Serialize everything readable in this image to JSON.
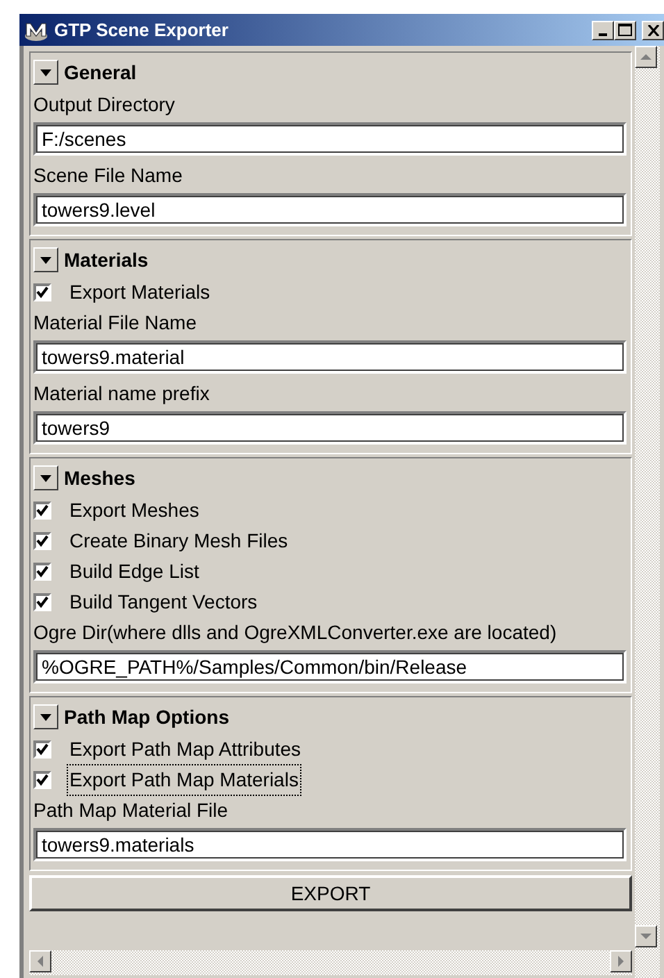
{
  "window": {
    "title": "GTP Scene Exporter"
  },
  "sections": [
    {
      "title": "General",
      "expanded": true,
      "items": [
        {
          "kind": "label",
          "text": "Output Directory"
        },
        {
          "kind": "field",
          "value": "F:/scenes"
        },
        {
          "kind": "label",
          "text": "Scene File Name"
        },
        {
          "kind": "field",
          "value": "towers9.level"
        }
      ]
    },
    {
      "title": "Materials",
      "expanded": true,
      "items": [
        {
          "kind": "checkbox",
          "text": "Export Materials",
          "checked": true,
          "focused": false
        },
        {
          "kind": "label",
          "text": "Material File Name"
        },
        {
          "kind": "field",
          "value": "towers9.material"
        },
        {
          "kind": "label",
          "text": "Material name prefix"
        },
        {
          "kind": "field",
          "value": "towers9"
        }
      ]
    },
    {
      "title": "Meshes",
      "expanded": true,
      "items": [
        {
          "kind": "checkbox",
          "text": "Export Meshes",
          "checked": true,
          "focused": false
        },
        {
          "kind": "checkbox",
          "text": "Create Binary Mesh Files",
          "checked": true,
          "focused": false
        },
        {
          "kind": "checkbox",
          "text": "Build Edge List",
          "checked": true,
          "focused": false
        },
        {
          "kind": "checkbox",
          "text": "Build Tangent Vectors",
          "checked": true,
          "focused": false
        },
        {
          "kind": "label",
          "text": "Ogre Dir(where dlls and OgreXMLConverter.exe are located)"
        },
        {
          "kind": "field",
          "value": "%OGRE_PATH%/Samples/Common/bin/Release"
        }
      ]
    },
    {
      "title": "Path Map Options",
      "expanded": true,
      "items": [
        {
          "kind": "checkbox",
          "text": "Export Path Map Attributes",
          "checked": true,
          "focused": false
        },
        {
          "kind": "checkbox",
          "text": "Export Path Map Materials",
          "checked": true,
          "focused": true
        },
        {
          "kind": "label",
          "text": "Path Map Material File"
        },
        {
          "kind": "field",
          "value": "towers9.materials"
        }
      ]
    }
  ],
  "export_button": "EXPORT"
}
